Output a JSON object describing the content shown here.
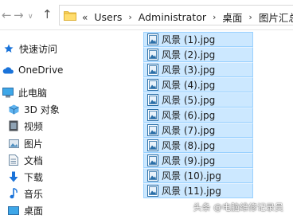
{
  "nav": {
    "back_icon": "arrow-left-icon",
    "forward_icon": "arrow-right-icon",
    "recent_icon": "chevron-down-icon",
    "up_icon": "arrow-up-icon"
  },
  "address": {
    "overflow": "«",
    "crumbs": [
      "Users",
      "Administrator",
      "桌面",
      "图片汇总"
    ]
  },
  "sidebar": {
    "items": [
      {
        "label": "快速访问",
        "icon": "star-icon"
      },
      {
        "label": "OneDrive",
        "icon": "cloud-icon"
      },
      {
        "label": "此电脑",
        "icon": "computer-icon"
      },
      {
        "label": "3D 对象",
        "icon": "cube-icon"
      },
      {
        "label": "视频",
        "icon": "video-icon"
      },
      {
        "label": "图片",
        "icon": "picture-icon"
      },
      {
        "label": "文档",
        "icon": "document-icon"
      },
      {
        "label": "下载",
        "icon": "download-icon"
      },
      {
        "label": "音乐",
        "icon": "music-icon"
      },
      {
        "label": "桌面",
        "icon": "desktop-icon"
      }
    ]
  },
  "files": [
    "风景 (1).jpg",
    "风景 (2).jpg",
    "风景 (3).jpg",
    "风景 (4).jpg",
    "风景 (5).jpg",
    "风景 (6).jpg",
    "风景 (7).jpg",
    "风景 (8).jpg",
    "风景 (9).jpg",
    "风景 (10).jpg",
    "风景 (11).jpg"
  ],
  "watermark": "头条 @电脑维修记录员",
  "colors": {
    "selection_bg": "#cce8ff",
    "selection_border": "#99d1ff",
    "folder_yellow": "#f6cf5a",
    "accent_blue": "#1a73d9"
  }
}
